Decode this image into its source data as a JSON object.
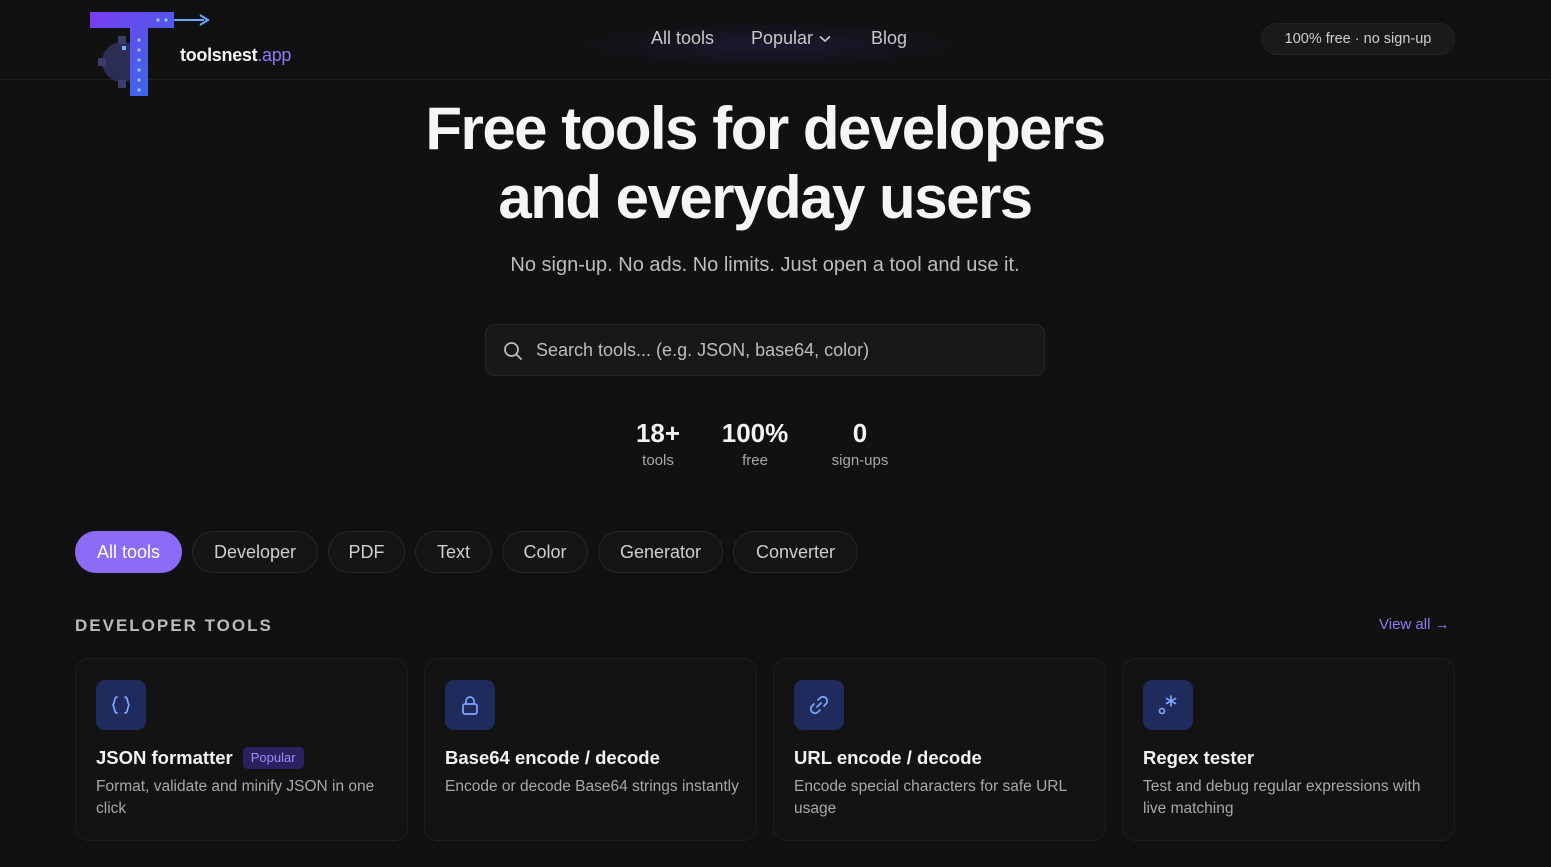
{
  "brand": {
    "name": "toolsnest",
    "tld": ".app"
  },
  "nav": {
    "items": [
      {
        "label": "All tools"
      },
      {
        "label": "Popular"
      },
      {
        "label": "Blog"
      }
    ],
    "badge": "100% free · no sign-up"
  },
  "hero": {
    "title_line1": "Free tools for developers",
    "title_line2": "and everyday users",
    "subtitle": "No sign-up. No ads. No limits. Just open a tool and use it."
  },
  "search": {
    "placeholder": "Search tools... (e.g. JSON, base64, color)",
    "value": ""
  },
  "stats": [
    {
      "value": "18+",
      "label": "tools"
    },
    {
      "value": "100%",
      "label": "free"
    },
    {
      "value": "0",
      "label": "sign-ups"
    }
  ],
  "filters": [
    {
      "label": "All tools",
      "active": true
    },
    {
      "label": "Developer"
    },
    {
      "label": "PDF"
    },
    {
      "label": "Text"
    },
    {
      "label": "Color"
    },
    {
      "label": "Generator"
    },
    {
      "label": "Converter"
    }
  ],
  "section": {
    "title": "DEVELOPER TOOLS",
    "view_all": "View all →"
  },
  "cards": [
    {
      "icon": "braces-icon",
      "title": "JSON formatter",
      "tag": "Popular",
      "desc": "Format, validate and minify JSON in one click"
    },
    {
      "icon": "lock-icon",
      "title": "Base64 encode / decode",
      "desc": "Encode or decode Base64 strings instantly"
    },
    {
      "icon": "link-icon",
      "title": "URL encode / decode",
      "desc": "Encode special characters for safe URL usage"
    },
    {
      "icon": "regex-icon",
      "title": "Regex tester",
      "desc": "Test and debug regular expressions with live matching"
    }
  ],
  "colors": {
    "accent": "#8b6cf6",
    "background": "#111111",
    "icon_tile": "#1e2b5c"
  }
}
